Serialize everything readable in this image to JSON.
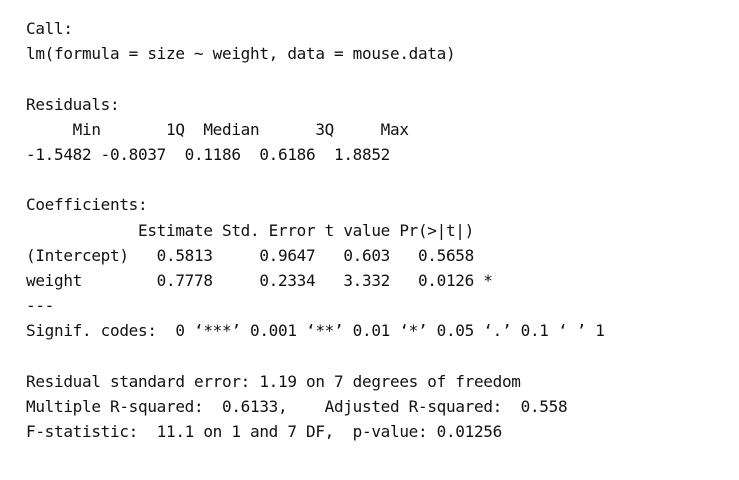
{
  "call": {
    "header": "Call:",
    "formula": "lm(formula = size ~ weight, data = mouse.data)"
  },
  "residuals": {
    "header": "Residuals:",
    "labels_line": "     Min       1Q  Median      3Q     Max",
    "values_line": "-1.5482 -0.8037  0.1186  0.6186  1.8852"
  },
  "coefficients": {
    "header": "Coefficients:",
    "columns_line": "            Estimate Std. Error t value Pr(>|t|)",
    "rows": [
      "(Intercept)   0.5813     0.9647   0.603   0.5658",
      "weight        0.7778     0.2334   3.332   0.0126 *"
    ]
  },
  "signif": {
    "separator": "---",
    "codes_line": "Signif. codes:  0 ‘***’ 0.001 ‘**’ 0.01 ‘*’ 0.05 ‘.’ 0.1 ‘ ’ 1"
  },
  "summary": {
    "rse_line": "Residual standard error: 1.19 on 7 degrees of freedom",
    "r2_line": "Multiple R-squared:  0.6133,\tAdjusted R-squared:  0.558",
    "f_line": "F-statistic:  11.1 on 1 and 7 DF,  p-value: 0.01256"
  }
}
